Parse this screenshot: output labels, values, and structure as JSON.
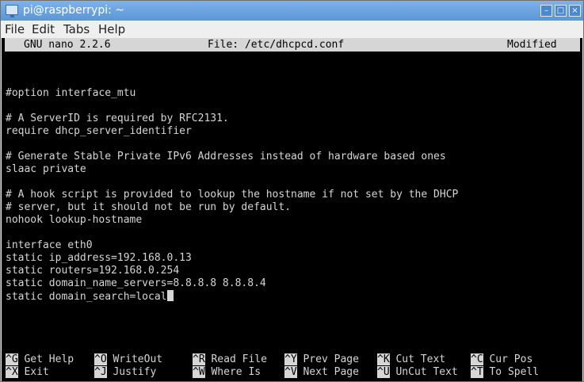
{
  "window": {
    "title": "pi@raspberrypi: ~",
    "buttons": {
      "minimize": "–",
      "maximize": "□",
      "close": "×"
    }
  },
  "menubar": {
    "items": [
      "File",
      "Edit",
      "Tabs",
      "Help"
    ]
  },
  "nano": {
    "version": "GNU nano 2.2.6",
    "file": "File: /etc/dhcpcd.conf",
    "status": "Modified",
    "lines": [
      "#option interface_mtu",
      "",
      "# A ServerID is required by RFC2131.",
      "require dhcp_server_identifier",
      "",
      "# Generate Stable Private IPv6 Addresses instead of hardware based ones",
      "slaac private",
      "",
      "# A hook script is provided to lookup the hostname if not set by the DHCP",
      "# server, but it should not be run by default.",
      "nohook lookup-hostname",
      "",
      "interface eth0",
      "static ip_address=192.168.0.13",
      "static routers=192.168.0.254",
      "static domain_name_servers=8.8.8.8 8.8.8.4",
      "static domain_search=local"
    ],
    "shortcuts_row1": [
      {
        "key": "^G",
        "label": " Get Help"
      },
      {
        "key": "^O",
        "label": " WriteOut"
      },
      {
        "key": "^R",
        "label": " Read File"
      },
      {
        "key": "^Y",
        "label": " Prev Page"
      },
      {
        "key": "^K",
        "label": " Cut Text"
      },
      {
        "key": "^C",
        "label": " Cur Pos"
      }
    ],
    "shortcuts_row2": [
      {
        "key": "^X",
        "label": " Exit"
      },
      {
        "key": "^J",
        "label": " Justify"
      },
      {
        "key": "^W",
        "label": " Where Is"
      },
      {
        "key": "^V",
        "label": " Next Page"
      },
      {
        "key": "^U",
        "label": " UnCut Text"
      },
      {
        "key": "^T",
        "label": " To Spell"
      }
    ]
  }
}
